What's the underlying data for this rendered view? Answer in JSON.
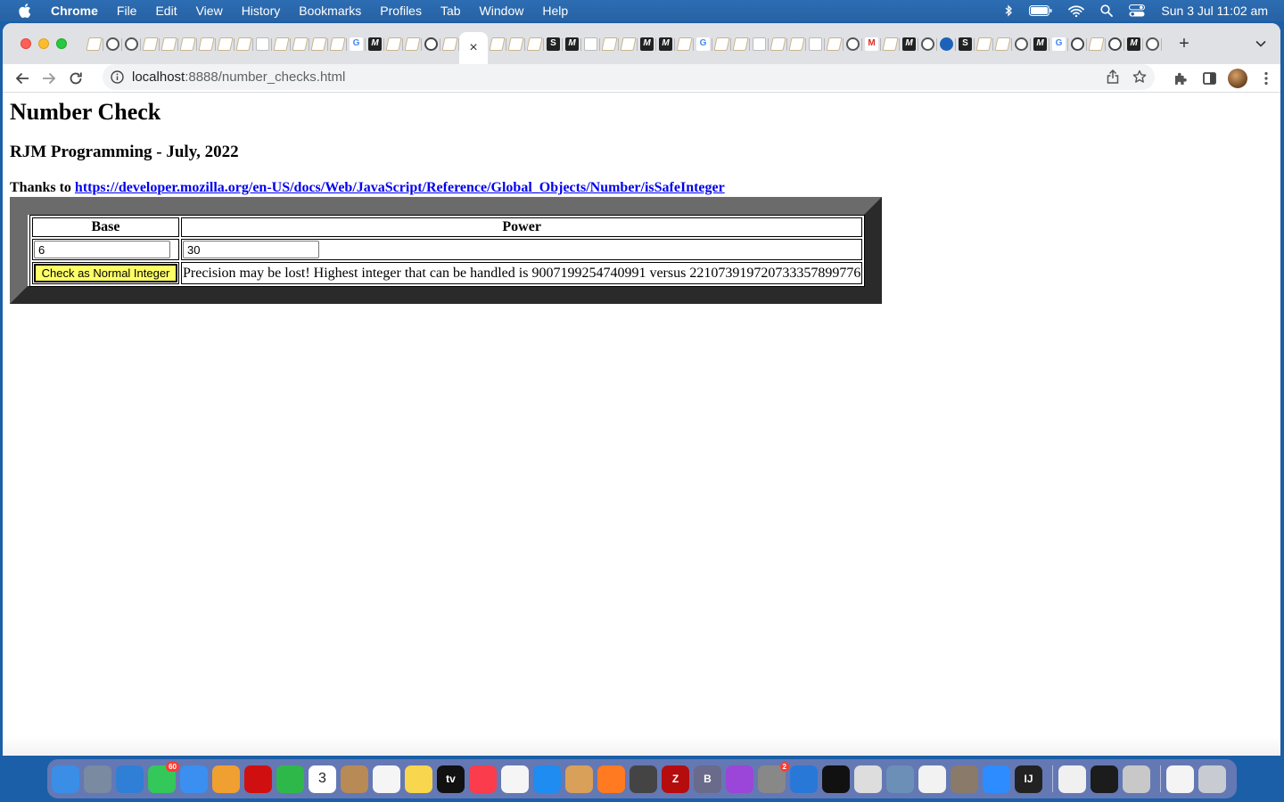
{
  "menubar": {
    "app_name": "Chrome",
    "items": [
      "File",
      "Edit",
      "View",
      "History",
      "Bookmarks",
      "Profiles",
      "Tab",
      "Window",
      "Help"
    ],
    "clock": "Sun 3 Jul  11:02 am"
  },
  "browser": {
    "tabs": [
      "pen",
      "globe",
      "globe",
      "pen",
      "pen",
      "pen",
      "pen",
      "pen",
      "pen",
      "blank",
      "pen",
      "pen",
      "pen",
      "pen",
      "G",
      "M",
      "pen",
      "pen",
      "owl",
      "pen",
      "active",
      "pen",
      "pen",
      "pen",
      "S",
      "M",
      "blank",
      "pen",
      "pen",
      "M",
      "M",
      "pen",
      "G",
      "pen",
      "pen",
      "blank",
      "pen",
      "pen",
      "blank",
      "pen",
      "globe",
      "gmail",
      "pen",
      "M",
      "globe",
      "dot",
      "S",
      "pen",
      "pen",
      "globe",
      "M",
      "G",
      "owl",
      "pen",
      "owl",
      "M",
      "globe"
    ],
    "active_tab_close": "×",
    "new_tab": "+",
    "url_host": "localhost",
    "url_rest": ":8888/number_checks.html"
  },
  "page": {
    "title": "Number Check",
    "subtitle": "RJM Programming - July, 2022",
    "thanks_prefix": "Thanks to ",
    "thanks_link": "https://developer.mozilla.org/en-US/docs/Web/JavaScript/Reference/Global_Objects/Number/isSafeInteger",
    "table": {
      "header_base": "Base",
      "header_power": "Power",
      "base_value": "6",
      "power_value": "30",
      "button_label": "Check as Normal Integer",
      "result_text": "Precision may be lost!  Highest integer that can be handled is 9007199254740991 versus 221073919720733357899776"
    }
  },
  "dock": {
    "icons": [
      {
        "name": "finder",
        "color": "#3a8ee6"
      },
      {
        "name": "launchpad",
        "color": "#7a8aa0"
      },
      {
        "name": "safari",
        "color": "#2f7fd6"
      },
      {
        "name": "messages",
        "color": "#34c759",
        "badge": "60"
      },
      {
        "name": "mail",
        "color": "#3b8ff0"
      },
      {
        "name": "photos",
        "color": "#f0a030"
      },
      {
        "name": "opera",
        "color": "#d01010"
      },
      {
        "name": "facetime",
        "color": "#2fb84a"
      },
      {
        "name": "calendar",
        "color": "#ffffff",
        "label": "3"
      },
      {
        "name": "contacts",
        "color": "#b88a55"
      },
      {
        "name": "reminders",
        "color": "#f5f5f5"
      },
      {
        "name": "notes",
        "color": "#f8d64e"
      },
      {
        "name": "tv",
        "color": "#111111",
        "label": "tv"
      },
      {
        "name": "music",
        "color": "#fa3c4c"
      },
      {
        "name": "news",
        "color": "#f5f5f5"
      },
      {
        "name": "app-store",
        "color": "#1e8cf0"
      },
      {
        "name": "paint",
        "color": "#d9a05a"
      },
      {
        "name": "firefox",
        "color": "#ff7a20"
      },
      {
        "name": "calculator",
        "color": "#444444"
      },
      {
        "name": "filezilla",
        "color": "#b50d0d",
        "label": "Z"
      },
      {
        "name": "bbedit",
        "color": "#6a6a8a",
        "label": "B"
      },
      {
        "name": "podcasts",
        "color": "#9b46d8"
      },
      {
        "name": "system-preferences",
        "color": "#888888",
        "badge": "2"
      },
      {
        "name": "xcode",
        "color": "#2878d8"
      },
      {
        "name": "terminal",
        "color": "#111111"
      },
      {
        "name": "sequel-pro",
        "color": "#dddddd"
      },
      {
        "name": "preview",
        "color": "#6c8fb8"
      },
      {
        "name": "file",
        "color": "#f2f2f2"
      },
      {
        "name": "gimp",
        "color": "#8a7a6a"
      },
      {
        "name": "zoom",
        "color": "#2d8cff"
      },
      {
        "name": "intellij",
        "color": "#222222",
        "label": "IJ"
      },
      {
        "name": "sep"
      },
      {
        "name": "chrome",
        "color": "#f0f0f0"
      },
      {
        "name": "console",
        "color": "#1c1c1c"
      },
      {
        "name": "automator",
        "color": "#c8c8c8"
      },
      {
        "name": "sep"
      },
      {
        "name": "chrome-doc",
        "color": "#f4f4f4"
      },
      {
        "name": "trash",
        "color": "#c8ccd2"
      }
    ]
  }
}
